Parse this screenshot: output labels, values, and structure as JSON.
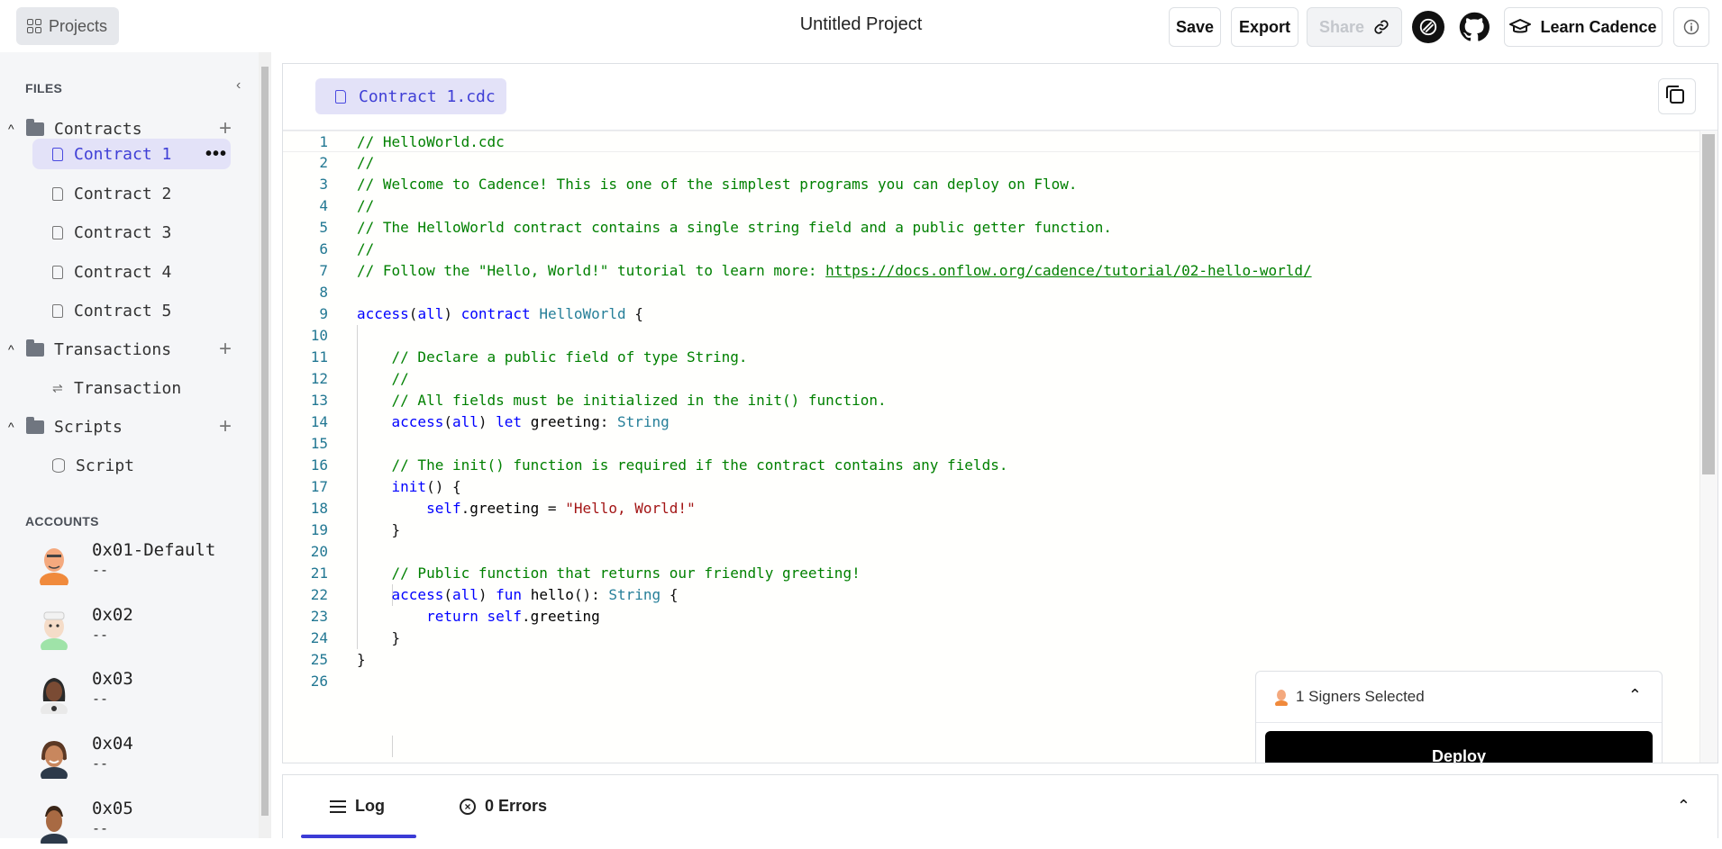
{
  "header": {
    "projects_label": "Projects",
    "project_title": "Untitled Project",
    "save_label": "Save",
    "export_label": "Export",
    "share_label": "Share",
    "learn_label": "Learn Cadence",
    "icons": [
      "grid-icon",
      "link-icon",
      "flow-icon",
      "github-icon",
      "graduation-cap-icon",
      "info-icon"
    ]
  },
  "sidebar": {
    "files_label": "FILES",
    "accounts_label": "ACCOUNTS",
    "folders": {
      "contracts": "Contracts",
      "transactions": "Transactions",
      "scripts": "Scripts"
    },
    "contracts": [
      "Contract 1",
      "Contract 2",
      "Contract 3",
      "Contract 4",
      "Contract 5"
    ],
    "transactions": [
      "Transaction"
    ],
    "scripts": [
      "Script"
    ],
    "active_file": "Contract 1",
    "accounts": [
      {
        "name": "0x01-Default",
        "balance": "--"
      },
      {
        "name": "0x02",
        "balance": "--"
      },
      {
        "name": "0x03",
        "balance": "--"
      },
      {
        "name": "0x04",
        "balance": "--"
      },
      {
        "name": "0x05",
        "balance": "--"
      }
    ]
  },
  "editor": {
    "tab_label": "Contract 1.cdc",
    "code_lines": [
      "// HelloWorld.cdc",
      "//",
      "// Welcome to Cadence! This is one of the simplest programs you can deploy on Flow.",
      "//",
      "// The HelloWorld contract contains a single string field and a public getter function.",
      "//",
      "// Follow the \"Hello, World!\" tutorial to learn more: https://docs.onflow.org/cadence/tutorial/02-hello-world/",
      "",
      "access(all) contract HelloWorld {",
      "",
      "    // Declare a public field of type String.",
      "    //",
      "    // All fields must be initialized in the init() function.",
      "    access(all) let greeting: String",
      "",
      "    // The init() function is required if the contract contains any fields.",
      "    init() {",
      "        self.greeting = \"Hello, World!\"",
      "    }",
      "",
      "    // Public function that returns our friendly greeting!",
      "    access(all) fun hello(): String {",
      "        return self.greeting",
      "    }",
      "}",
      ""
    ]
  },
  "signers": {
    "label": "1 Signers Selected",
    "deploy_label": "Deploy"
  },
  "bottom_panel": {
    "log_label": "Log",
    "errors_label": "0 Errors"
  }
}
